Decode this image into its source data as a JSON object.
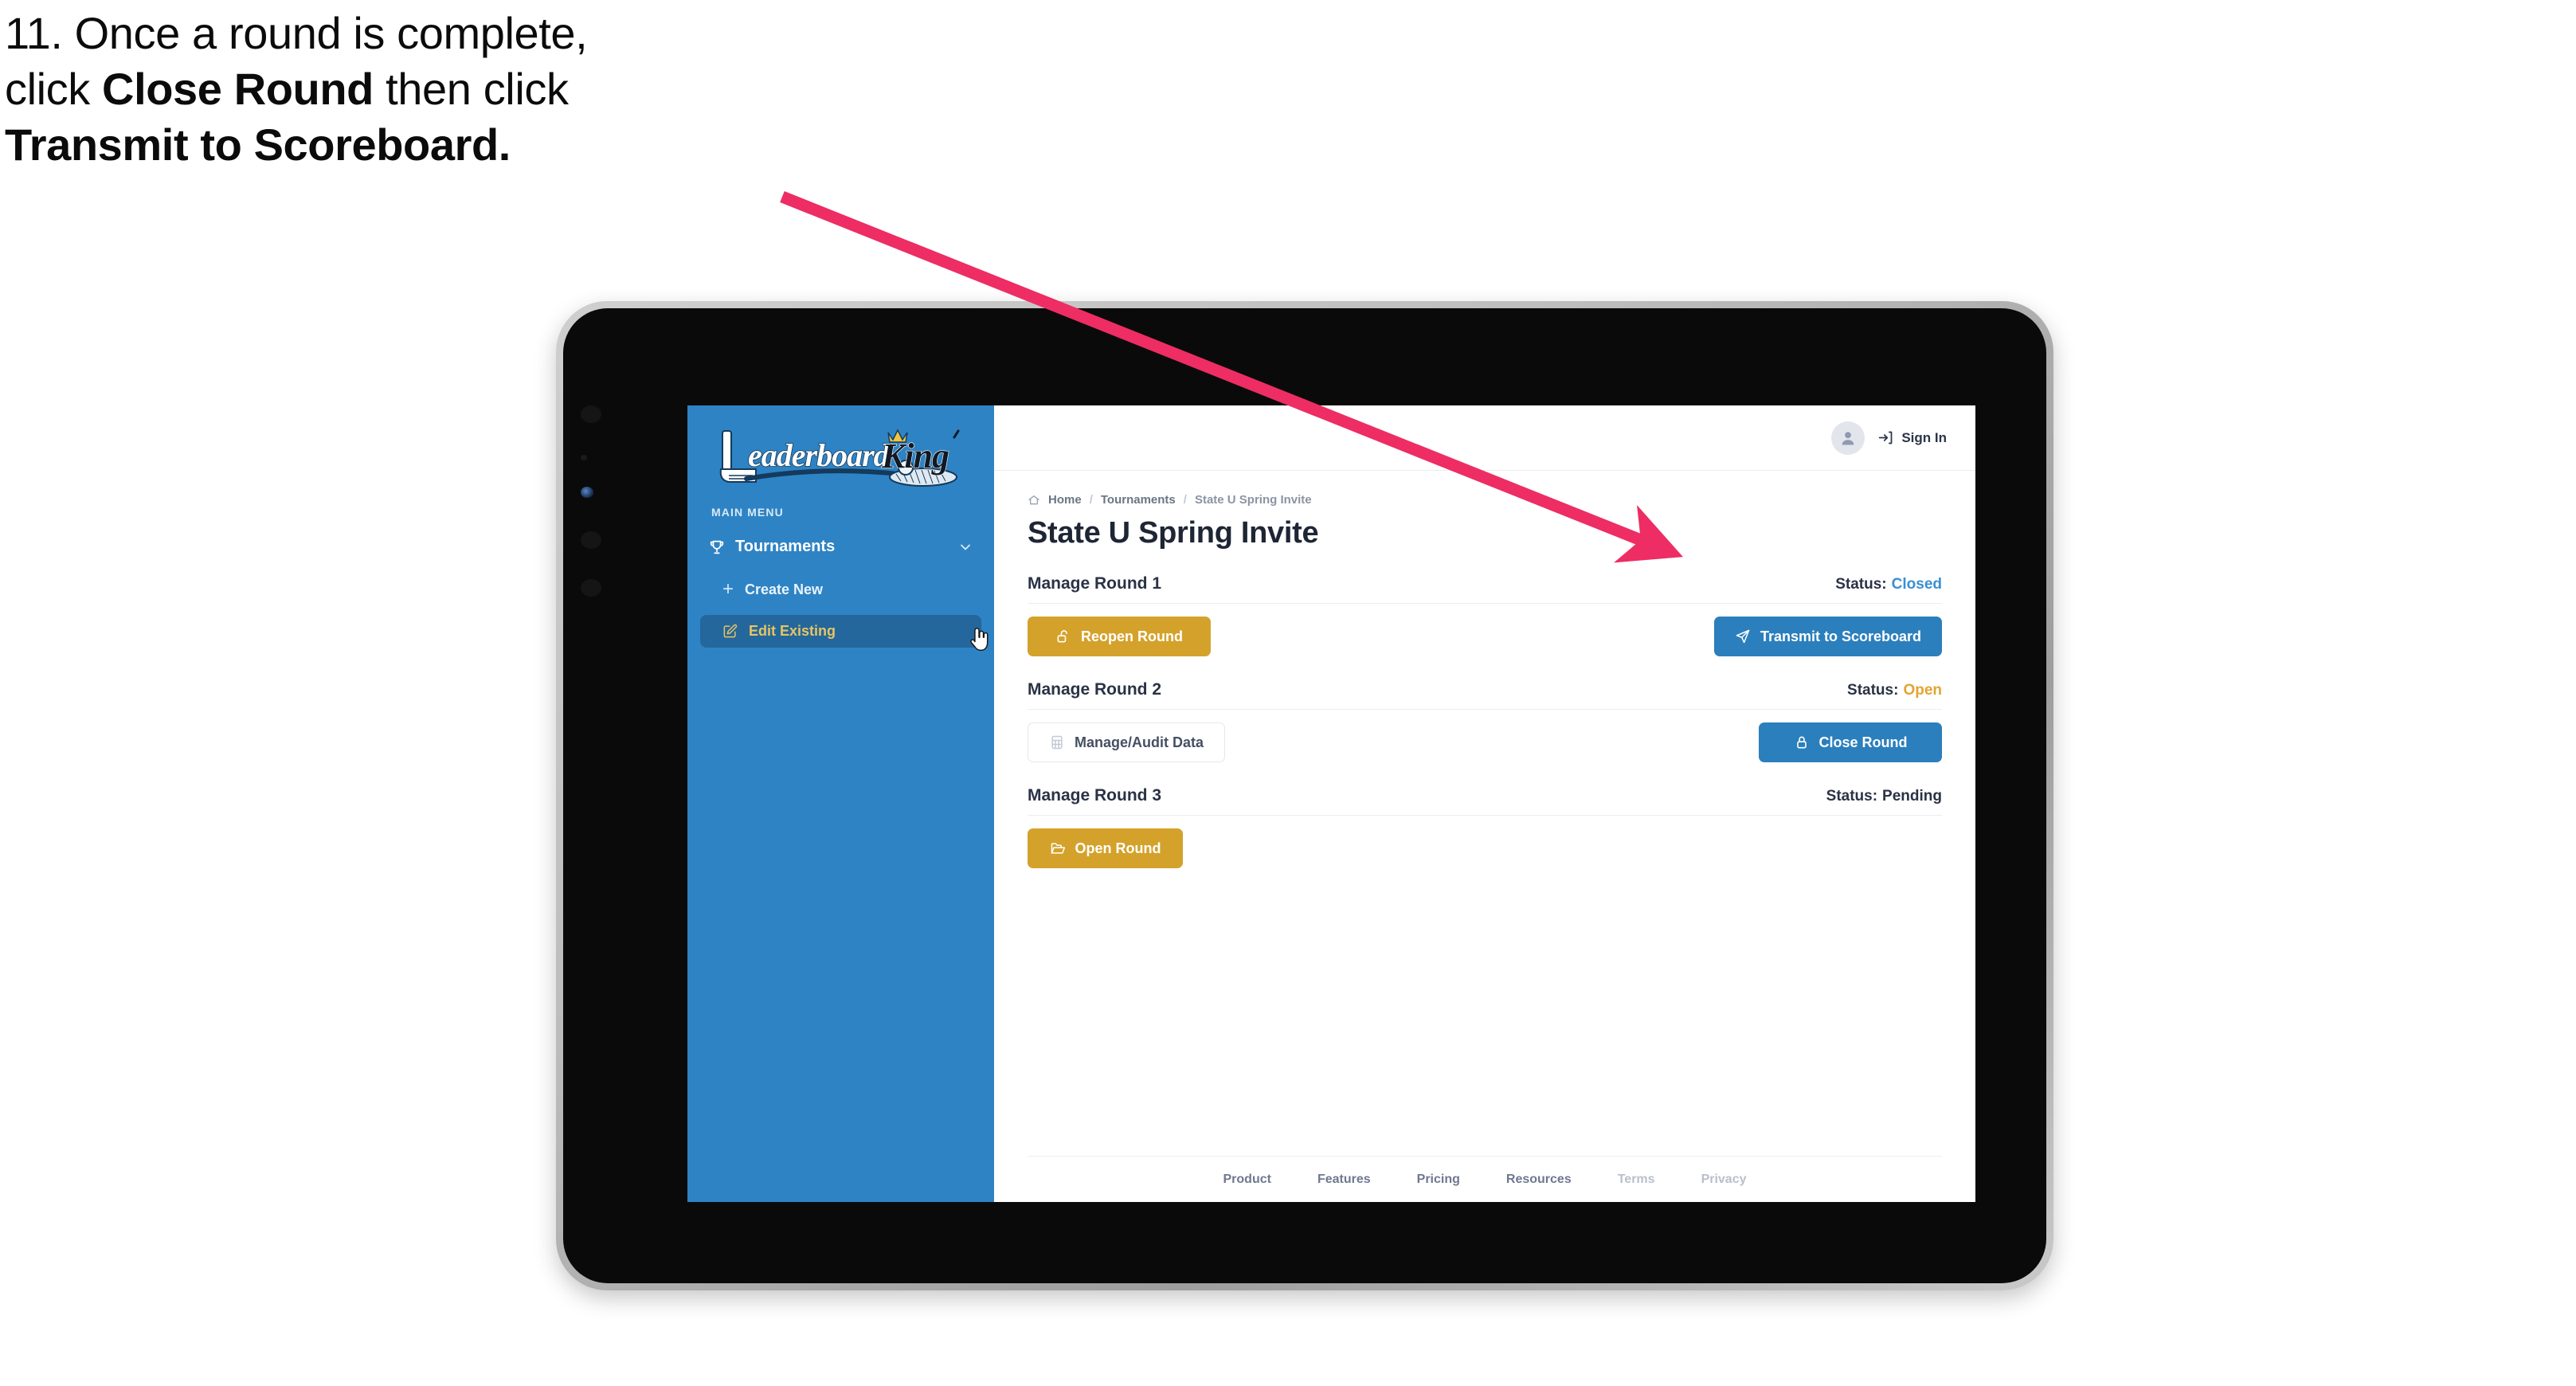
{
  "caption": {
    "line1_plain": "11. Once a round is complete,",
    "line2_pre": "click ",
    "line2_bold": "Close Round",
    "line2_post": " then click",
    "line3_bold": "Transmit to Scoreboard."
  },
  "sidebar": {
    "logo_text_primary": "Leaderboard",
    "logo_text_secondary": "King",
    "menu_label": "MAIN MENU",
    "items": [
      {
        "label": "Tournaments",
        "icon": "trophy-icon",
        "chevron": "chevron-down-icon"
      },
      {
        "label": "Create New",
        "icon": "plus-icon"
      },
      {
        "label": "Edit Existing",
        "icon": "edit-square-icon"
      }
    ],
    "bg_color": "#2e83c4",
    "active_bg_color": "#24679c",
    "active_text_color": "#e7c463"
  },
  "topbar": {
    "signin_label": "Sign In",
    "avatar_icon": "user-icon",
    "signin_icon": "login-arrow-icon"
  },
  "breadcrumb": {
    "home_icon": "home-icon",
    "items": [
      "Home",
      "Tournaments",
      "State U Spring Invite"
    ],
    "separator": "/"
  },
  "page": {
    "title": "State U Spring Invite"
  },
  "rounds": [
    {
      "name": "Manage Round 1",
      "status_label": "Status:",
      "status_value": "Closed",
      "status_color": "#3a8fd4",
      "left_button": {
        "label": "Reopen Round",
        "style": "amber",
        "icon": "unlock-icon"
      },
      "right_button": {
        "label": "Transmit to Scoreboard",
        "style": "blue",
        "icon": "send-icon"
      }
    },
    {
      "name": "Manage Round 2",
      "status_label": "Status:",
      "status_value": "Open",
      "status_color": "#e2a430",
      "left_button": {
        "label": "Manage/Audit Data",
        "style": "ghost",
        "icon": "grid-table-icon"
      },
      "right_button": {
        "label": "Close Round",
        "style": "blue",
        "icon": "lock-icon"
      }
    },
    {
      "name": "Manage Round 3",
      "status_label": "Status:",
      "status_value": "Pending",
      "status_color": "#2a3245",
      "left_button": {
        "label": "Open Round",
        "style": "amber",
        "icon": "folder-open-icon"
      },
      "right_button": null
    }
  ],
  "footer": {
    "links": [
      {
        "label": "Product",
        "muted": false
      },
      {
        "label": "Features",
        "muted": false
      },
      {
        "label": "Pricing",
        "muted": false
      },
      {
        "label": "Resources",
        "muted": false
      },
      {
        "label": "Terms",
        "muted": true
      },
      {
        "label": "Privacy",
        "muted": true
      }
    ]
  },
  "annotation": {
    "arrow_color": "#ed2d63",
    "arrow_name": "callout-arrow"
  },
  "cursor": {
    "icon": "pointing-hand-cursor"
  }
}
